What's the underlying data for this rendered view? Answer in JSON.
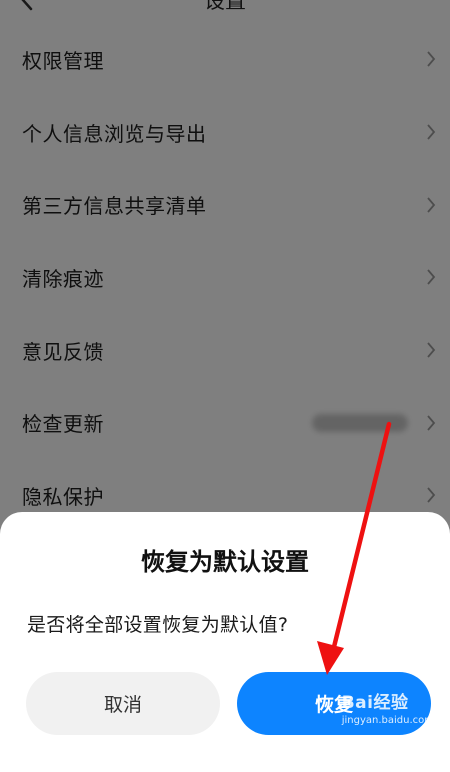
{
  "header": {
    "title": "设置"
  },
  "settings_list": [
    {
      "label": "权限管理"
    },
    {
      "label": "个人信息浏览与导出"
    },
    {
      "label": "第三方信息共享清单"
    },
    {
      "label": "清除痕迹"
    },
    {
      "label": "意见反馈"
    },
    {
      "label": "检查更新"
    },
    {
      "label": "隐私保护"
    }
  ],
  "dialog": {
    "title": "恢复为默认设置",
    "message": "是否将全部设置恢复为默认值?",
    "cancel_label": "取消",
    "confirm_label": "恢复"
  },
  "watermark": {
    "brand": "Bai经验",
    "sub": "jingyan.baidu.com"
  },
  "colors": {
    "accent": "#0d84ff",
    "annotation_arrow": "#ee1111"
  }
}
